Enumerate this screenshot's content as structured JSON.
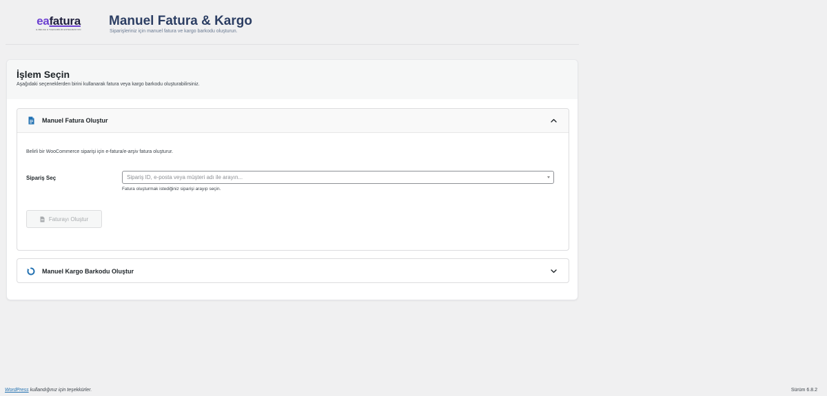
{
  "logo": {
    "ea_text": "ea",
    "brand_text": "fatura",
    "tagline": "E-BELGE & TAŞINABİLİR ENTEGRASYON"
  },
  "header": {
    "title": "Manuel Fatura & Kargo",
    "subtitle": "Siparişleriniz için manuel fatura ve kargo barkodu oluşturun."
  },
  "card": {
    "title": "İşlem Seçin",
    "description": "Aşağıdaki seçeneklerden birini kullanarak fatura veya kargo barkodu oluşturabilirsiniz."
  },
  "invoice_section": {
    "title": "Manuel Fatura Oluştur",
    "expanded": true,
    "icon": "document-icon",
    "description": "Belirli bir WooCommerce siparişi için e-fatura/e-arşiv fatura oluşturur.",
    "order_select": {
      "label": "Sipariş Seç",
      "placeholder": "Sipariş ID, e-posta veya müşteri adı ile arayın...",
      "help": "Fatura oluşturmak istediğiniz siparişi arayıp seçin."
    },
    "create_button": {
      "label": "Faturayı Oluştur",
      "disabled": true
    }
  },
  "cargo_section": {
    "title": "Manuel Kargo Barkodu Oluştur",
    "expanded": false,
    "icon": "refresh-icon"
  },
  "footer": {
    "wordpress_link": "WordPress",
    "thanks_text": " kullandığınız için teşekkürler.",
    "version": "Sürüm 6.8.2"
  },
  "colors": {
    "accent_purple": "#6c3fd1",
    "title_navy": "#2c3e63",
    "icon_blue": "#2271b1",
    "background": "#f0f0f1"
  }
}
